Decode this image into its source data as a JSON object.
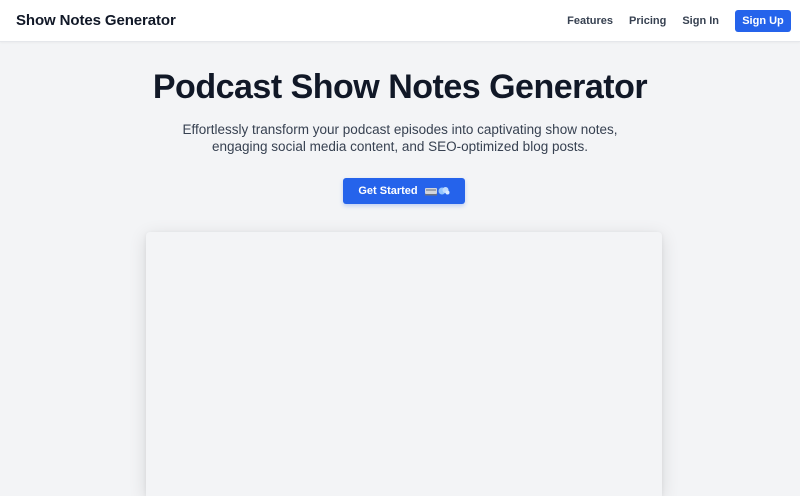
{
  "nav": {
    "brand": "Show Notes Generator",
    "links": [
      "Features",
      "Pricing",
      "Sign In"
    ],
    "signup_label": "Sign Up"
  },
  "hero": {
    "title": "Podcast Show Notes Generator",
    "subtitle": "Effortlessly transform your podcast episodes into captivating show notes, engaging social media content, and SEO-optimized blog posts.",
    "cta_label": "Get Started",
    "cta_icon": "rocket-dash-icon"
  },
  "colors": {
    "accent": "#2563eb",
    "background": "#f3f4f6",
    "text": "#111827"
  }
}
